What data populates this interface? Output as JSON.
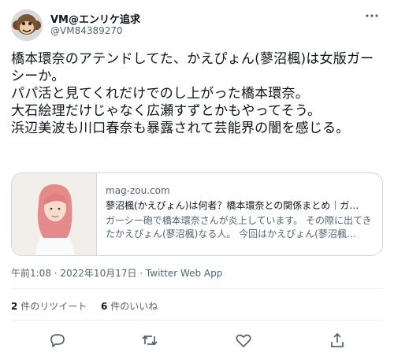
{
  "user": {
    "name": "VM@エンリケ追求",
    "handle": "@VM84389270"
  },
  "tweet": {
    "text": "橋本環奈のアテンドしてた、かえぴょん(蓼沼楓)は女版ガーシーか。\nパパ活と見てくれだけでのし上がった橋本環奈。\n大石絵理だけじゃなく広瀬すずとかもやってそう。\n浜辺美波も川口春奈も暴露されて芸能界の闇を感じる。"
  },
  "card": {
    "domain": "mag-zou.com",
    "title": "蓼沼楓(かえぴょん)は何者？橋本環奈との関係まとめ｜ガ…",
    "description": "ガーシー砲で橋本環奈さんが炎上しています。 その際に出てきたかえぴょん(蓼沼楓)なる人。 今回はかえぴょん(蓼沼楓…"
  },
  "meta": {
    "timestamp": "午前1:08 · 2022年10月17日 · Twitter Web App"
  },
  "stats": {
    "retweets_count": "2",
    "retweets_label": "件のリツイート",
    "likes_count": "6",
    "likes_label": "件のいいね"
  },
  "icons": {
    "more": "more-icon",
    "reply": "reply-icon",
    "retweet": "retweet-icon",
    "like": "like-icon",
    "share": "share-icon"
  },
  "colors": {
    "text": "#0f1419",
    "secondary": "#536471",
    "border": "#cfd9de"
  }
}
